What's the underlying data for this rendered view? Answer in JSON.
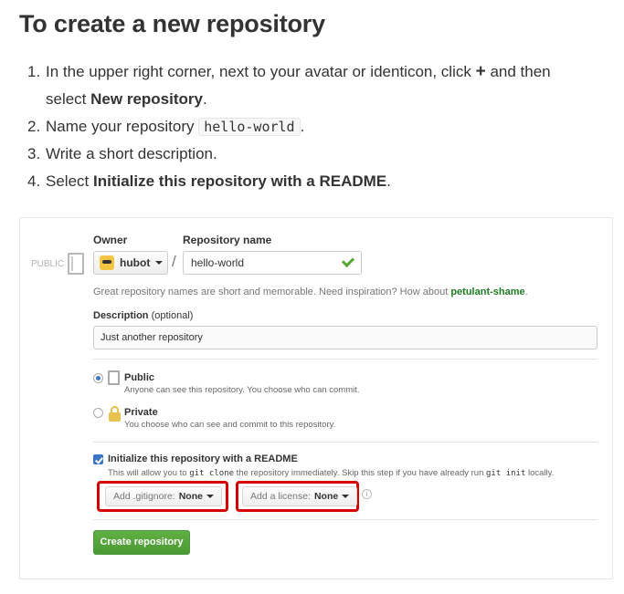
{
  "heading": "To create a new repository",
  "steps": [
    {
      "num": "1.",
      "text_a": "In the upper right corner, next to your avatar or identicon, click",
      "plus": "+",
      "text_b": "and then",
      "text_c": "select",
      "bold": "New repository",
      "end": "."
    },
    {
      "num": "2.",
      "text_a": "Name your repository",
      "code": "hello-world",
      "end": "."
    },
    {
      "num": "3.",
      "text_a": "Write a short description."
    },
    {
      "num": "4.",
      "text_a": "Select",
      "bold": "Initialize this repository with a README",
      "end": "."
    }
  ],
  "form": {
    "public_label": "PUBLIC",
    "owner_label": "Owner",
    "owner_value": "hubot",
    "slash": "/",
    "repo_name_label": "Repository name",
    "repo_name_value": "hello-world",
    "hint_text": "Great repository names are short and memorable. Need inspiration? How about",
    "hint_suggestion": "petulant-shame",
    "hint_end": ".",
    "description_label": "Description",
    "description_optional": "(optional)",
    "description_value": "Just another repository",
    "public_title": "Public",
    "public_sub": "Anyone can see this repository. You choose who can commit.",
    "private_title": "Private",
    "private_sub": "You choose who can see and commit to this repository.",
    "init_title": "Initialize this repository with a README",
    "init_sub_a": "This will allow you to",
    "init_sub_code1": "git clone",
    "init_sub_b": "the repository immediately. Skip this step if you have already run",
    "init_sub_code2": "git init",
    "init_sub_c": "locally.",
    "gitignore_prefix": "Add .gitignore:",
    "gitignore_value": "None",
    "license_prefix": "Add a license:",
    "license_value": "None",
    "info_glyph": "i",
    "create_button": "Create repository"
  },
  "colors": {
    "accent_green": "#60b044",
    "highlight_red": "#d60000",
    "link_green": "#1e7e22"
  }
}
